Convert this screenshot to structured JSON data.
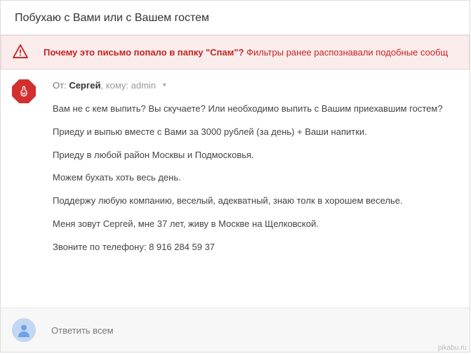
{
  "subject": "Побухаю с Вами или с Вашем гостем",
  "spam": {
    "question": "Почему это письмо попало в папку \"Спам\"?",
    "reason": "Фильтры ранее распознавали подобные сообщ"
  },
  "from": {
    "label": "От:",
    "name": "Сергей",
    "to_label": "кому:",
    "to_value": "admin"
  },
  "body": [
    "Вам не с кем выпить? Вы скучаете? Или необходимо выпить с Вашим приехавшим гостем?",
    "Приеду и выпью вместе с Вами за 3000 рублей (за день) + Ваши напитки.",
    "Приеду в любой район Москвы и Подмосковья.",
    "Можем бухать хоть весь день.",
    "Поддержу любую компанию, веселый, адекватный, знаю толк в хорошем веселье.",
    "Меня зовут Сергей, мне 37 лет, живу в Москве на Щелковской.",
    "Звоните по телефону: 8 916 284 59 37"
  ],
  "reply": {
    "label": "Ответить всем"
  },
  "watermark": "pikabu.ru"
}
